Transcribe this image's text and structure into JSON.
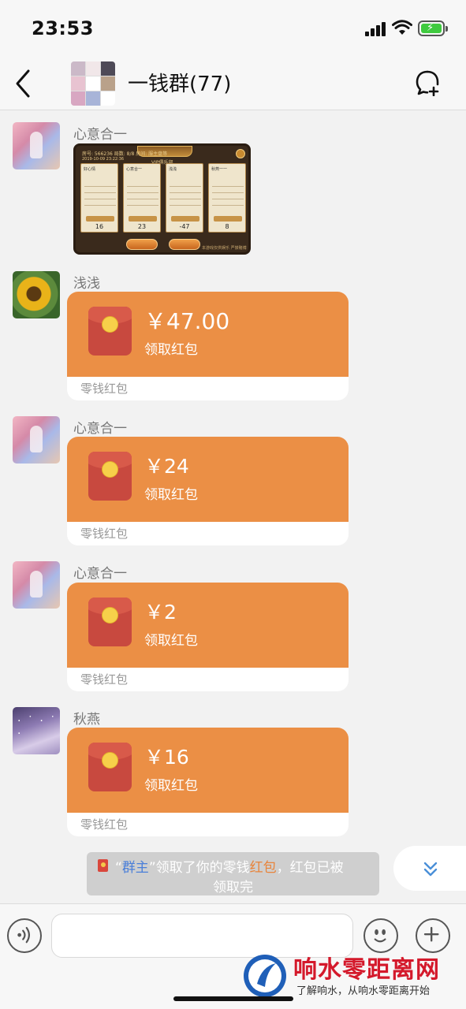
{
  "status_bar": {
    "time": "23:53"
  },
  "header": {
    "title": "一钱群(77)"
  },
  "messages": [
    {
      "sender": "心意合一",
      "type": "image",
      "screenshot": {
        "header": "房号: 566236   局数: 8/8   房间:    服主盘等",
        "date": "2019-10-09 23:22:36",
        "club": "VIP俱乐部",
        "players": [
          {
            "name": "好心情",
            "score": "16"
          },
          {
            "name": "心意合一",
            "score": "23"
          },
          {
            "name": "浅浅",
            "score": "-47"
          },
          {
            "name": "秋燕一一",
            "score": "8"
          }
        ],
        "note": "本游戏仅供娱乐 严禁赌博"
      }
    },
    {
      "sender": "浅浅",
      "type": "red_packet",
      "amount": "￥47.00",
      "action": "领取红包",
      "footer": "零钱红包"
    },
    {
      "sender": "心意合一",
      "type": "red_packet",
      "amount": "￥24",
      "action": "领取红包",
      "footer": "零钱红包"
    },
    {
      "sender": "心意合一",
      "type": "red_packet",
      "amount": "￥2",
      "action": "领取红包",
      "footer": "零钱红包"
    },
    {
      "sender": "秋燕",
      "type": "red_packet",
      "amount": "￥16",
      "action": "领取红包",
      "footer": "零钱红包"
    }
  ],
  "system_notice": {
    "quote_open": "“",
    "who": "群主",
    "quote_close": "”",
    "middle": "领取了你的零钱",
    "packet": "红包",
    "tail": "，红包已被",
    "line2": "领取完"
  },
  "input_bar": {
    "placeholder": ""
  },
  "watermark": {
    "title": "响水零距离网",
    "subtitle": "了解响水，从响水零距离开始"
  },
  "colors": {
    "packet_orange": "#eb8f45",
    "envelope_red": "#c8493f",
    "watermark_red": "#d4192b",
    "blue_name": "#4a7fd9"
  },
  "icons": [
    "back-icon",
    "add-chat-icon",
    "voice-icon",
    "emoji-icon",
    "plus-icon",
    "chevron-double-down-icon",
    "red-packet-icon"
  ]
}
